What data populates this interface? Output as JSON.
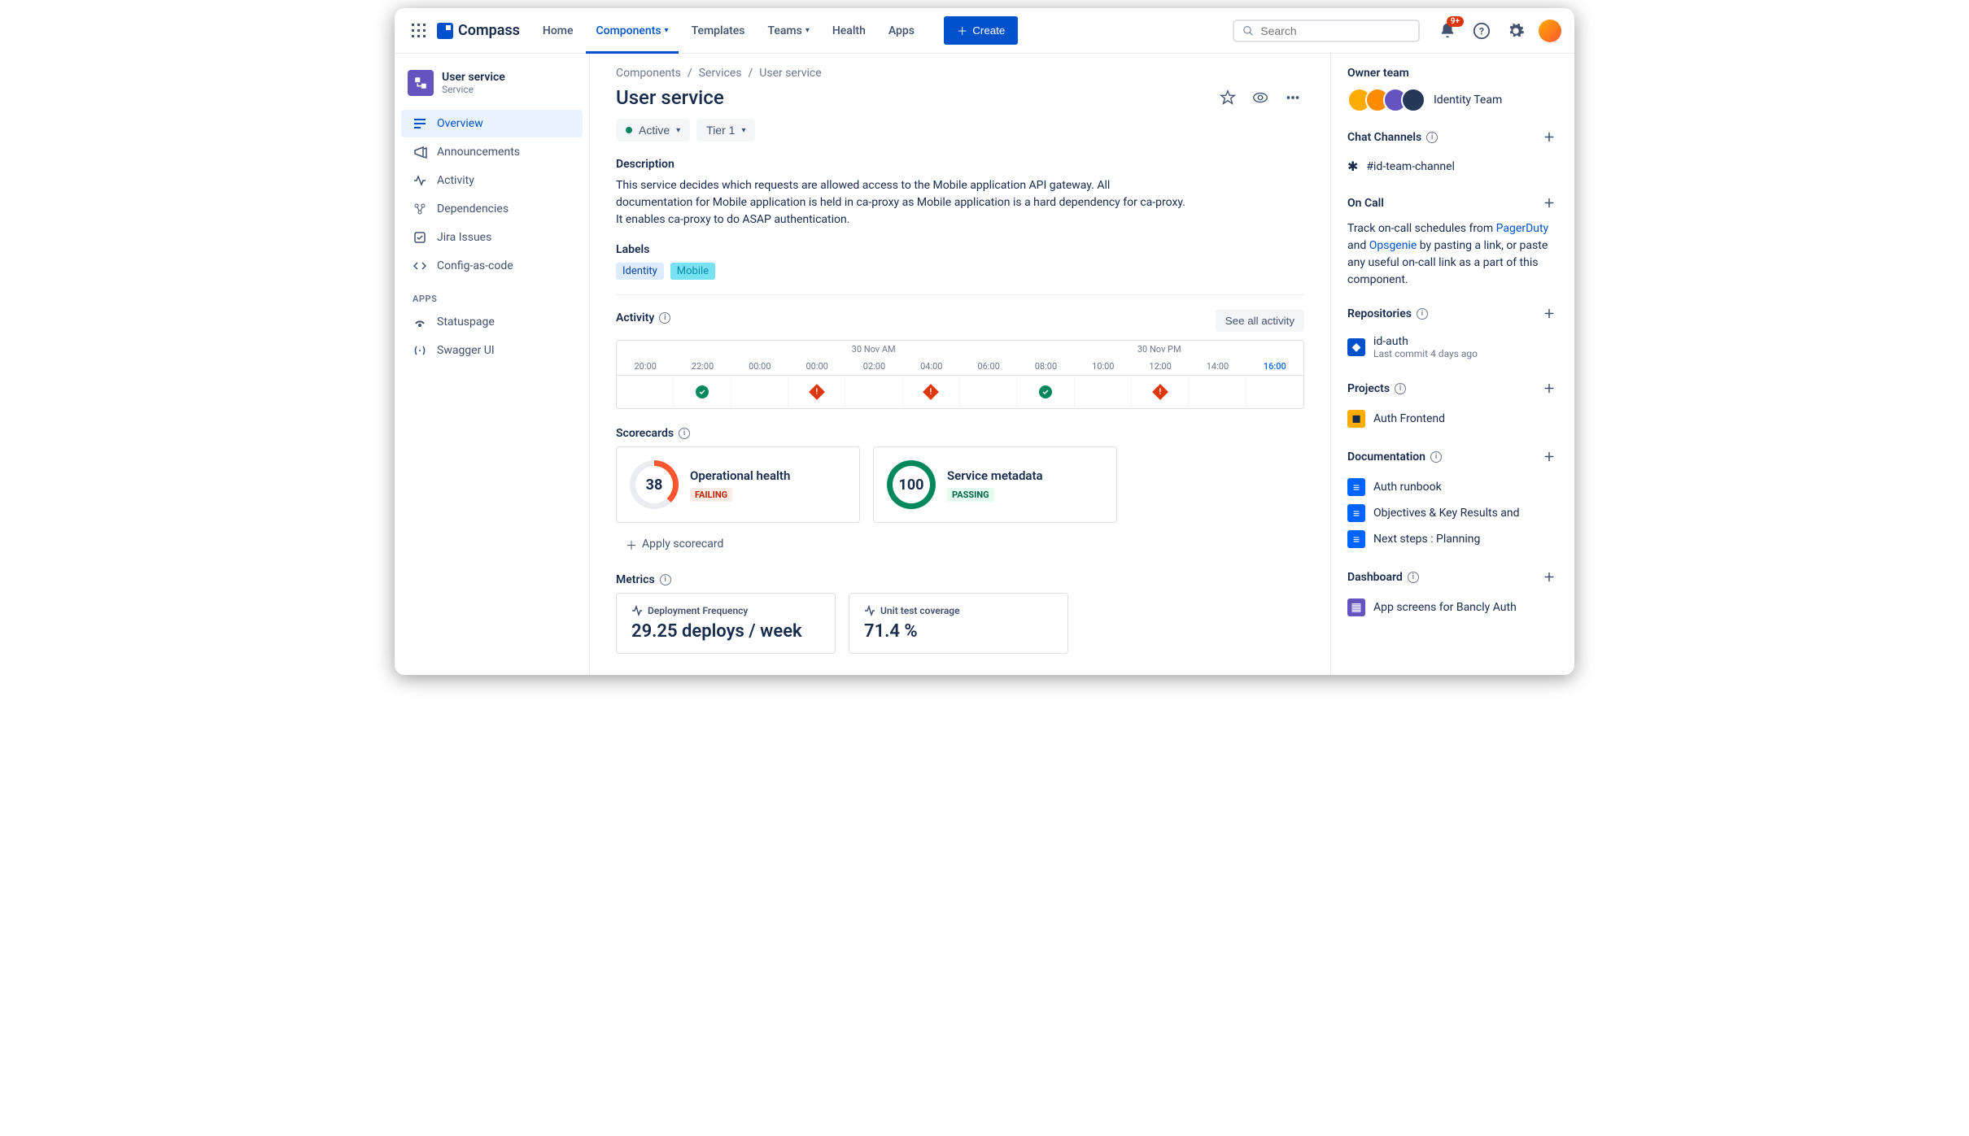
{
  "topnav": {
    "product": "Compass",
    "items": [
      "Home",
      "Components",
      "Templates",
      "Teams",
      "Health",
      "Apps"
    ],
    "active": "Components",
    "create": "Create",
    "search_placeholder": "Search",
    "notif_badge": "9+"
  },
  "sidebar": {
    "title": "User service",
    "subtitle": "Service",
    "items": [
      {
        "label": "Overview",
        "icon": "overview",
        "active": true
      },
      {
        "label": "Announcements",
        "icon": "announce"
      },
      {
        "label": "Activity",
        "icon": "activity"
      },
      {
        "label": "Dependencies",
        "icon": "deps"
      },
      {
        "label": "Jira Issues",
        "icon": "jira"
      },
      {
        "label": "Config-as-code",
        "icon": "code"
      }
    ],
    "apps_label": "APPS",
    "apps": [
      {
        "label": "Statuspage",
        "icon": "status"
      },
      {
        "label": "Swagger UI",
        "icon": "swagger"
      }
    ]
  },
  "breadcrumb": [
    "Components",
    "Services",
    "User service"
  ],
  "page": {
    "title": "User service",
    "status": "Active",
    "tier": "Tier 1",
    "description_h": "Description",
    "description": "This service decides which requests are allowed access to the Mobile application API gateway. All documentation for Mobile application is held in ca-proxy as Mobile application is a hard dependency for ca-proxy. It enables ca-proxy to do ASAP authentication.",
    "labels_h": "Labels",
    "labels": [
      {
        "text": "Identity",
        "bg": "#DEEBFF",
        "fg": "#0747A6"
      },
      {
        "text": "Mobile",
        "bg": "#B3F5FF",
        "fg": "#008DA6"
      }
    ]
  },
  "activity": {
    "h": "Activity",
    "see_all": "See all activity",
    "date_am": "30 Nov AM",
    "date_pm": "30 Nov PM",
    "hours": [
      "20:00",
      "22:00",
      "00:00",
      "00:00",
      "02:00",
      "04:00",
      "06:00",
      "08:00",
      "10:00",
      "12:00",
      "14:00",
      "16:00"
    ],
    "current_idx": 11,
    "events": [
      "",
      "ok",
      "",
      "bad",
      "",
      "bad",
      "",
      "ok",
      "",
      "bad",
      "",
      ""
    ]
  },
  "scorecards": {
    "h": "Scorecards",
    "cards": [
      {
        "score": "38",
        "title": "Operational health",
        "status": "FAILING",
        "ring": "ring-38",
        "tag": "tag-fail"
      },
      {
        "score": "100",
        "title": "Service metadata",
        "status": "PASSING",
        "ring": "ring-100",
        "tag": "tag-pass"
      }
    ],
    "apply": "Apply scorecard"
  },
  "metrics": {
    "h": "Metrics",
    "cards": [
      {
        "label": "Deployment Frequency",
        "value": "29.25 deploys / week"
      },
      {
        "label": "Unit test coverage",
        "value": "71.4 %"
      }
    ]
  },
  "right": {
    "owner_h": "Owner team",
    "team": "Identity Team",
    "chat_h": "Chat Channels",
    "chat_channel": "#id-team-channel",
    "oncall_h": "On Call",
    "oncall_text1": "Track on-call schedules from ",
    "oncall_link1": "PagerDuty",
    "oncall_text2": " and ",
    "oncall_link2": "Opsgenie",
    "oncall_text3": " by pasting a link, or paste any useful on-call link as a part of this component.",
    "repos_h": "Repositories",
    "repo_name": "id-auth",
    "repo_sub": "Last commit 4 days ago",
    "projects_h": "Projects",
    "project_name": "Auth Frontend",
    "docs_h": "Documentation",
    "docs": [
      "Auth runbook",
      "Objectives & Key Results and",
      "Next steps : Planning"
    ],
    "dash_h": "Dashboard",
    "dash_item": "App screens for Bancly Auth"
  }
}
